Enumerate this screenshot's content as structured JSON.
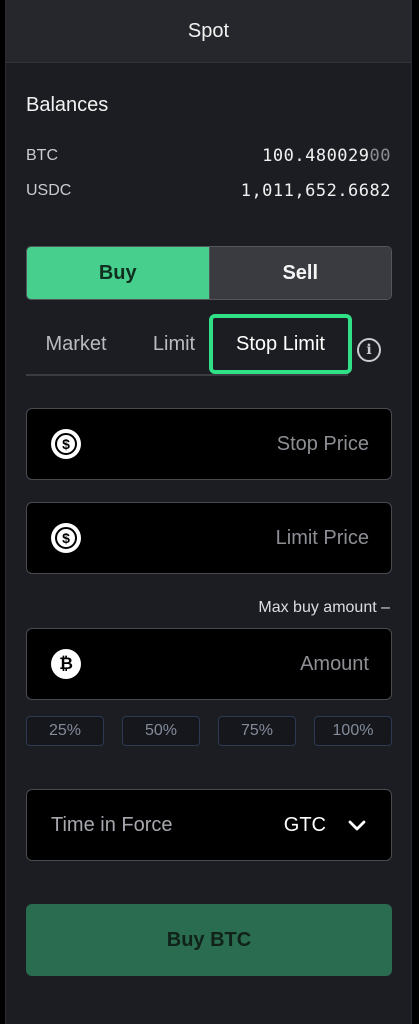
{
  "header": {
    "title": "Spot"
  },
  "balances": {
    "title": "Balances",
    "items": [
      {
        "asset": "BTC",
        "value_main": "100.480029",
        "value_dim": "00"
      },
      {
        "asset": "USDC",
        "value_main": "1,011,652.6682",
        "value_dim": ""
      }
    ]
  },
  "side": {
    "buy_label": "Buy",
    "sell_label": "Sell",
    "selected": "Buy"
  },
  "order_types": {
    "tabs": [
      {
        "label": "Market"
      },
      {
        "label": "Limit"
      },
      {
        "label": "Stop Limit"
      }
    ],
    "selected": "Stop Limit",
    "info_icon": "info-icon"
  },
  "fields": {
    "stop_price": {
      "placeholder": "Stop Price",
      "icon": "usdc-icon"
    },
    "limit_price": {
      "placeholder": "Limit Price",
      "icon": "usdc-icon"
    },
    "amount": {
      "placeholder": "Amount",
      "icon": "btc-icon"
    }
  },
  "max_buy": "Max buy amount –",
  "percent_buttons": [
    {
      "label": "25%"
    },
    {
      "label": "50%"
    },
    {
      "label": "75%"
    },
    {
      "label": "100%"
    }
  ],
  "time_in_force": {
    "label": "Time in Force",
    "value": "GTC",
    "icon": "chevron-down-icon"
  },
  "submit": {
    "label": "Buy BTC"
  },
  "colors": {
    "accent": "#47cf8e",
    "highlight": "#2fe087",
    "submit_bg": "#2a6c4f"
  }
}
